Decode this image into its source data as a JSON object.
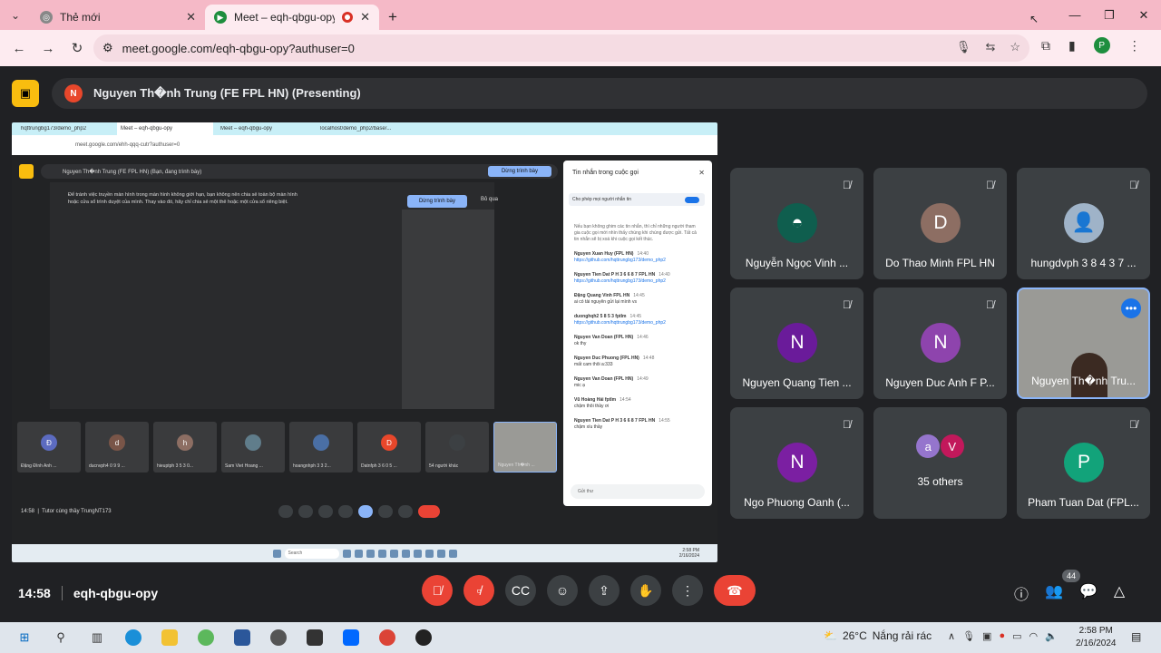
{
  "browser": {
    "tabs": [
      {
        "title": "Thẻ mới",
        "active": false
      },
      {
        "title": "Meet – eqh-qbgu-opy",
        "active": true
      }
    ],
    "url": "meet.google.com/eqh-qbgu-opy?authuser=0",
    "profile_initial": "P"
  },
  "presenting": {
    "avatar_initial": "N",
    "label": "Nguyen Th�nh Trung (FE FPL HN) (Presenting)"
  },
  "shared_screen": {
    "tabs": [
      "hqttrungbg173/demo_php2",
      "Meet – eqh-qbgu-opy",
      "Meet – eqh-qbgu-opy",
      "localhost/demo_php2/base/..."
    ],
    "url": "meet.google.com/ehh-qqq-cutr?authuser=0",
    "presenting_label": "Nguyen Th�nh Trung (FE FPL HN) (Bạn, đang trình bày)",
    "stop_button": "Dừng trình bày",
    "notice": "Để tránh việc truyền màn hình trong màn hình không giới hạn, bạn không nên chia sẻ toàn bộ màn hình hoặc cửa sổ trình duyệt của mình. Thay vào đó, hãy chỉ chia sẻ một thẻ hoặc một cửa sổ riêng biệt.",
    "notice_button": "Dừng trình bày",
    "skip": "Bỏ qua",
    "chat": {
      "header": "Tin nhắn trong cuộc gọi",
      "allow": "Cho phép mọi người nhắn tin",
      "intro": "Nếu bạn không ghim các tin nhắn, thì chỉ những người tham gia cuộc gọi mới nhìn thấy chúng khi chúng được gửi. Tất cả tin nhắn sẽ bị xoá khi cuộc gọi kết thúc.",
      "messages": [
        {
          "user": "Nguyen Xuan Huy (FPL HN)",
          "time": "14:40",
          "text": "https://github.com/hqttrungbg173/demo_php2",
          "link": true
        },
        {
          "user": "Nguyen Tien Dat P H 3 6 6 8 7 FPL HN",
          "time": "14:40",
          "text": "https://github.com/hqttrungbg173/demo_php2",
          "link": true
        },
        {
          "user": "Đặng Quang Vinh FPL HN",
          "time": "14:45",
          "text": "ai có tài nguyên gửi lại mình vs",
          "link": false
        },
        {
          "user": "duonghqh2 5 8 5 3 fptlm",
          "time": "14:45",
          "text": "https://github.com/hqttrungbg173/demo_php2",
          "link": true
        },
        {
          "user": "Nguyen Van Doan (FPL HN)",
          "time": "14:46",
          "text": "ok thy",
          "link": false
        },
        {
          "user": "Nguyen Duc Phuong (FPL HN)",
          "time": "14:48",
          "text": "mất cam thôi a:333",
          "link": false
        },
        {
          "user": "Nguyen Van Doan (FPL HN)",
          "time": "14:49",
          "text": "mic ạ",
          "link": false
        },
        {
          "user": "Vũ Hoàng Hải fptlm",
          "time": "14:54",
          "text": "chậm thôi thầy ơi",
          "link": false
        },
        {
          "user": "Nguyen Tien Dat P H 3 6 6 8 7 FPL HN",
          "time": "14:55",
          "text": "chậm xíu thầy",
          "link": false
        }
      ],
      "send_placeholder": "Gửi thư"
    },
    "tiles": [
      {
        "initial": "Đ",
        "name": "Đặng Đình Anh ...",
        "color": "#5c6bc0"
      },
      {
        "initial": "d",
        "name": "ducnvph4 0 9 9 ...",
        "color": "#795548"
      },
      {
        "initial": "h",
        "name": "hieuptph 3 5 3 0...",
        "color": "#8d6e63"
      },
      {
        "initial": "",
        "name": "Sam Viet Hoang ...",
        "color": "#607d8b"
      },
      {
        "initial": "",
        "name": "hoangnhph 3 3 2...",
        "color": "#4a6fa5"
      },
      {
        "initial": "D",
        "name": "Datnfph 3 6 0 5 ...",
        "color": "#e8472b"
      },
      {
        "initial": "",
        "name": "54 người khác",
        "color": "#3c4043"
      },
      {
        "initial": "",
        "name": "Nguyen Th�nh ...",
        "color": "#9a9a96"
      }
    ],
    "time": "14:58",
    "meeting_label": "Tutor cùng thầy TrungNT173",
    "taskbar_search": "Search",
    "clock_time": "2:58 PM",
    "clock_date": "2/16/2024"
  },
  "participants": [
    {
      "name": "Nguyễn Ngọc Vinh ...",
      "initial": "",
      "color": "#0f5e4e",
      "muted": true
    },
    {
      "name": "Do Thao Minh FPL HN",
      "initial": "D",
      "color": "#8d6e63",
      "muted": true
    },
    {
      "name": "hungdvph 3 8 4 3 7 ...",
      "initial": "",
      "color": "#9fb3c8",
      "muted": true
    },
    {
      "name": "Nguyen Quang Tien ...",
      "initial": "N",
      "color": "#6a1b9a",
      "muted": true
    },
    {
      "name": "Nguyen Duc Anh F P...",
      "initial": "N",
      "color": "#8e44ad",
      "muted": true
    },
    {
      "name": "Nguyen Th�nh Tru...",
      "initial": "",
      "color": "#9a9a96",
      "muted": false
    },
    {
      "name": "Ngo Phuong Oanh (...",
      "initial": "N",
      "color": "#7b1fa2",
      "muted": true
    },
    {
      "name": "35 others",
      "initial": "",
      "color": "#3c4043",
      "muted": false
    },
    {
      "name": "Pham Tuan Dat (FPL...",
      "initial": "P",
      "color": "#12a37a",
      "muted": true
    }
  ],
  "others_avatars": [
    {
      "initial": "a",
      "color": "#9575cd"
    },
    {
      "initial": "V",
      "color": "#c2185b"
    }
  ],
  "meeting": {
    "time": "14:58",
    "code": "eqh-qbgu-opy",
    "people_count": "44"
  },
  "windows": {
    "weather": "26°C",
    "weather_text": "Nắng rải rác",
    "time": "2:58 PM",
    "date": "2/16/2024"
  }
}
